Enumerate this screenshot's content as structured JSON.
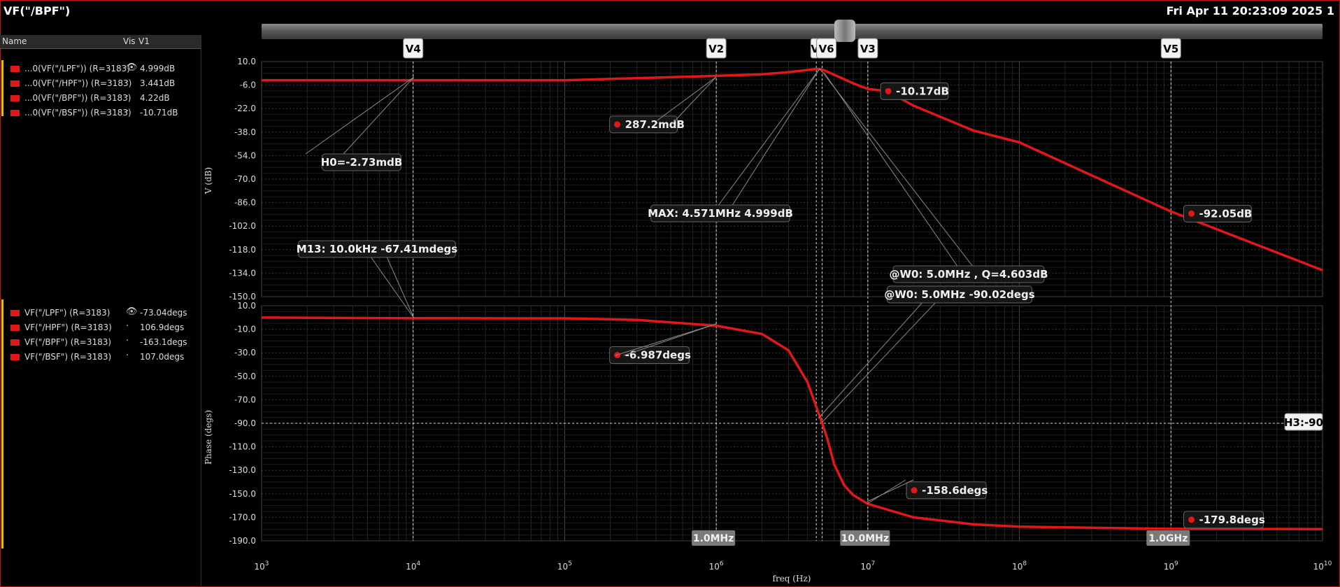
{
  "window": {
    "title": "VF(\"/BPF\")",
    "timestamp": "Fri Apr 11 20:23:09 2025  1"
  },
  "legend": {
    "header": {
      "name": "Name",
      "vis": "Vis",
      "v1": "V1"
    },
    "top_entries": [
      {
        "label": "...0(VF(\"/LPF\")) (R=3183)",
        "value": "4.999dB",
        "vis": "eye"
      },
      {
        "label": "...0(VF(\"/HPF\")) (R=3183)",
        "value": "3.441dB",
        "vis": "dot"
      },
      {
        "label": "...0(VF(\"/BPF\")) (R=3183)",
        "value": "4.22dB",
        "vis": "dot"
      },
      {
        "label": "...0(VF(\"/BSF\")) (R=3183)",
        "value": "-10.71dB",
        "vis": "dot"
      }
    ],
    "bottom_entries": [
      {
        "label": "VF(\"/LPF\") (R=3183)",
        "value": "-73.04degs",
        "vis": "eye"
      },
      {
        "label": "VF(\"/HPF\") (R=3183)",
        "value": "106.9degs",
        "vis": "dot"
      },
      {
        "label": "VF(\"/BPF\") (R=3183)",
        "value": "-163.1degs",
        "vis": "dot"
      },
      {
        "label": "VF(\"/BSF\") (R=3183)",
        "value": "107.0degs",
        "vis": "dot"
      }
    ]
  },
  "colors": {
    "trace": "#e01818",
    "grid": "#3a3a3a",
    "background": "#000000",
    "label_bg": "#161616"
  },
  "chart_data": {
    "type": "line",
    "x_scale": "log",
    "xlabel": "freq (Hz)",
    "xlim": [
      1000,
      10000000000
    ],
    "x_ticks": [
      {
        "v": 1000,
        "m": "10",
        "e": "3"
      },
      {
        "v": 10000,
        "m": "10",
        "e": "4"
      },
      {
        "v": 100000,
        "m": "10",
        "e": "5"
      },
      {
        "v": 1000000,
        "m": "10",
        "e": "6"
      },
      {
        "v": 10000000,
        "m": "10",
        "e": "7"
      },
      {
        "v": 100000000,
        "m": "10",
        "e": "8"
      },
      {
        "v": 1000000000,
        "m": "10",
        "e": "9"
      },
      {
        "v": 10000000000,
        "m": "10",
        "e": "10"
      }
    ],
    "top_plot": {
      "ylabel": "V (dB)",
      "ylim": [
        -150,
        10
      ],
      "y_ticks": [
        "10.0",
        "-6.0",
        "-22.0",
        "-38.0",
        "-54.0",
        "-70.0",
        "-86.0",
        "-102.0",
        "-118.0",
        "-134.0",
        "-150.0"
      ],
      "series": [
        {
          "x": [
            1000,
            10000,
            100000,
            1000000,
            2000000,
            3000000,
            4000000,
            4571000,
            5000000,
            6000000,
            8000000,
            10000000,
            13500000,
            20000000,
            50000000,
            100000000,
            1000000000,
            10000000000
          ],
          "y": [
            -2.73,
            -2.73,
            -2.7,
            0.287,
            1.3,
            2.8,
            4.3,
            4.999,
            4.6,
            1.0,
            -4.8,
            -8.6,
            -10.17,
            -20,
            -37,
            -45,
            -92.05,
            -132
          ]
        }
      ]
    },
    "bottom_plot": {
      "ylabel": "Phase (degs)",
      "ylim": [
        -190,
        10
      ],
      "y_ticks": [
        "10.0",
        "-10.0",
        "-30.0",
        "-50.0",
        "-70.0",
        "-90.0",
        "-110.0",
        "-130.0",
        "-150.0",
        "-170.0",
        "-190.0"
      ],
      "series": [
        {
          "x": [
            1000,
            10000,
            100000,
            300000,
            1000000,
            2000000,
            3000000,
            4000000,
            4600000,
            5000000,
            5400000,
            6000000,
            7000000,
            8000000,
            10000000,
            20000000,
            50000000,
            100000000,
            1000000000,
            10000000000
          ],
          "y": [
            -0.07,
            -0.67,
            -0.7,
            -2.0,
            -6.987,
            -14,
            -28,
            -55,
            -77,
            -90.02,
            -103,
            -125,
            -143,
            -151,
            -158.6,
            -170,
            -176,
            -178,
            -179.8,
            -180
          ]
        }
      ]
    },
    "vertical_markers": [
      {
        "name": "V4",
        "x": 10000
      },
      {
        "name": "V2",
        "x": 1000000
      },
      {
        "name": "V",
        "x": 4571000
      },
      {
        "name": "V6",
        "x": 5000000
      },
      {
        "name": "V3",
        "x": 10000000
      },
      {
        "name": "V5",
        "x": 1000000000
      }
    ],
    "horizontal_marker": {
      "name": "H3:-90",
      "y": -90
    },
    "x_marker_labels": [
      {
        "text": "1.0MHz",
        "x": 1000000
      },
      {
        "text": "10.0MHz",
        "x": 10000000
      },
      {
        "text": "1.0GHz",
        "x": 1000000000
      }
    ],
    "point_markers_top": [
      {
        "text": "-10.17dB",
        "x": 13500000,
        "y": -10.17
      },
      {
        "text": "287.2mdB",
        "x": 220000,
        "y": -32.8
      },
      {
        "text": "-92.05dB",
        "x": 1350000000,
        "y": -93.5
      }
    ],
    "point_markers_bottom": [
      {
        "text": "-6.987degs",
        "x": 220000,
        "y": -32
      },
      {
        "text": "-158.6degs",
        "x": 20000000,
        "y": -147
      },
      {
        "text": "-179.8degs",
        "x": 1350000000,
        "y": -172
      }
    ],
    "callouts": [
      {
        "text": "H0=-2.73mdB"
      },
      {
        "text": "MAX: 4.571MHz 4.999dB"
      },
      {
        "text": "M13: 10.0kHz -67.41mdegs"
      },
      {
        "text": "@W0: 5.0MHz , Q=4.603dB"
      },
      {
        "text": "@W0: 5.0MHz -90.02degs"
      }
    ]
  }
}
